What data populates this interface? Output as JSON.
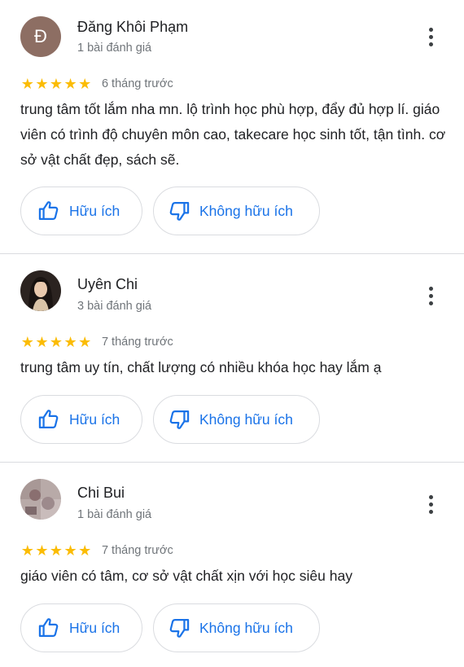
{
  "reviews": [
    {
      "author": "Đăng Khôi Phạm",
      "avatar_letter": "Đ",
      "review_count": "1 bài đánh giá",
      "rating": 5,
      "time": "6 tháng trước",
      "text": "trung tâm tốt lắm nha mn. lộ trình học phù hợp, đẩy đủ hợp lí. giáo viên có trình độ chuyên môn cao, takecare học sinh tốt, tận tình. cơ sở vật chất đẹp, sách sẽ."
    },
    {
      "author": "Uyên Chi",
      "review_count": "3 bài đánh giá",
      "rating": 5,
      "time": "7 tháng trước",
      "text": "trung tâm uy tín, chất lượng có nhiều khóa học hay lắm ạ"
    },
    {
      "author": "Chi Bui",
      "review_count": "1 bài đánh giá",
      "rating": 5,
      "time": "7 tháng trước",
      "text": "giáo viên có tâm, cơ sở vật chất xịn với học siêu hay"
    }
  ],
  "buttons": {
    "helpful": "Hữu ích",
    "not_helpful": "Không hữu ích"
  },
  "icons": {
    "more": "more-vert-icon",
    "helpful": "thumb-up-icon",
    "not_helpful": "thumb-down-icon",
    "star": "star-icon"
  },
  "colors": {
    "star": "#fbbc04",
    "action_blue": "#1a73e8",
    "letter_avatar_bg": "#8d6e63",
    "secondary_text": "#70757a",
    "divider": "#dadce0"
  }
}
